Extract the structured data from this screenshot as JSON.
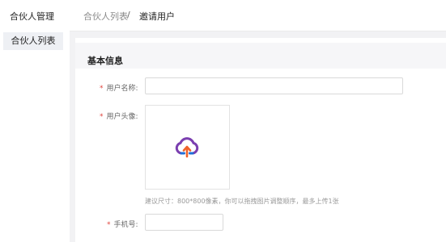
{
  "sidebar": {
    "title": "合伙人管理",
    "items": [
      {
        "label": "合伙人列表",
        "active": true
      }
    ]
  },
  "breadcrumb": {
    "parent": "合伙人列表",
    "separator": "/",
    "current": "邀请用户"
  },
  "form": {
    "section_title": "基本信息",
    "required_mark": "*",
    "fields": {
      "username": {
        "label": "用户名称:",
        "value": ""
      },
      "avatar": {
        "label": "用户头像:",
        "hint": "建议尺寸：800*800像素，你可以拖拽图片调整顺序，最多上传1张",
        "icon": "cloud-upload-icon"
      },
      "phone": {
        "label": "手机号:",
        "value": ""
      }
    }
  },
  "colors": {
    "required": "#e0443d",
    "icon_purple": "#7b3fb0",
    "icon_orange": "#f0622a",
    "icon_blue": "#1f6fd8"
  }
}
